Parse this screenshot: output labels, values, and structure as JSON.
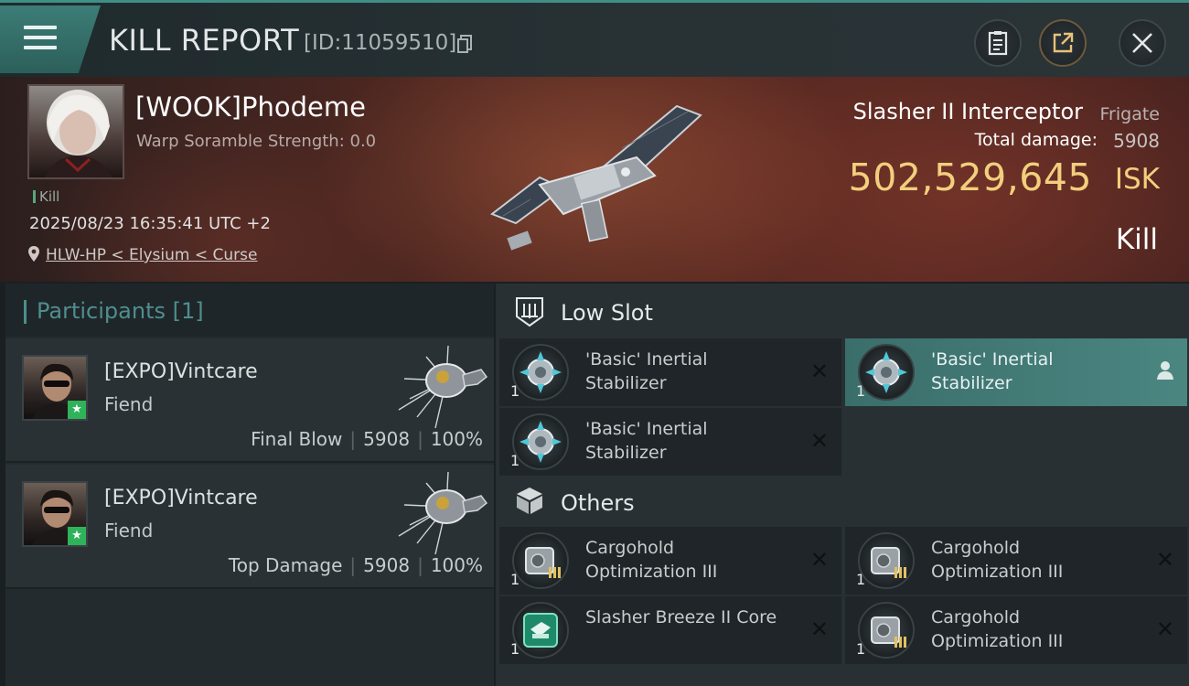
{
  "header": {
    "title": "KILL REPORT",
    "report_id": "[ID:11059510]"
  },
  "victim": {
    "name": "[WOOK]Phodeme",
    "scramble_strength": "Warp Soramble Strength: 0.0",
    "kill_tag": "Kill",
    "timestamp": "2025/08/23 16:35:41 UTC +2",
    "location": "HLW-HP < Elysium < Curse",
    "ship_name": "Slasher II Interceptor",
    "ship_class": "Frigate",
    "total_damage_label": "Total damage:",
    "total_damage": "5908",
    "isk_value": "502,529,645",
    "isk_unit": "ISK",
    "result": "Kill"
  },
  "participants": {
    "title": "Participants [1]",
    "items": [
      {
        "name": "[EXPO]Vintcare",
        "ship": "Fiend",
        "role": "Final Blow",
        "damage": "5908",
        "percent": "100%"
      },
      {
        "name": "[EXPO]Vintcare",
        "ship": "Fiend",
        "role": "Top Damage",
        "damage": "5908",
        "percent": "100%"
      }
    ]
  },
  "fitting": {
    "low_slot": {
      "title": "Low Slot",
      "items": [
        {
          "qty": "1",
          "name": "'Basic' Inertial Stabilizer"
        },
        {
          "qty": "1",
          "name": "'Basic' Inertial Stabilizer"
        },
        {
          "qty": "1",
          "name": "'Basic' Inertial Stabilizer"
        }
      ]
    },
    "others": {
      "title": "Others",
      "items": [
        {
          "qty": "1",
          "name": "Cargohold Optimization III"
        },
        {
          "qty": "1",
          "name": "Cargohold Optimization III"
        },
        {
          "qty": "1",
          "name": "Slasher Breeze II Core"
        },
        {
          "qty": "1",
          "name": "Cargohold Optimization III"
        }
      ]
    }
  },
  "icons": {
    "menu": "hamburger-icon",
    "copy": "copy-icon",
    "notes": "clipboard-icon",
    "share": "share-icon",
    "close": "close-icon",
    "location": "map-pin-icon",
    "low_slot": "low-slot-icon",
    "others": "box-icon",
    "destroyed": "x-icon",
    "dropped": "person-icon"
  },
  "colors": {
    "accent": "#3f8f86",
    "isk": "#f2cf7d",
    "star_badge": "#2fb35a"
  }
}
